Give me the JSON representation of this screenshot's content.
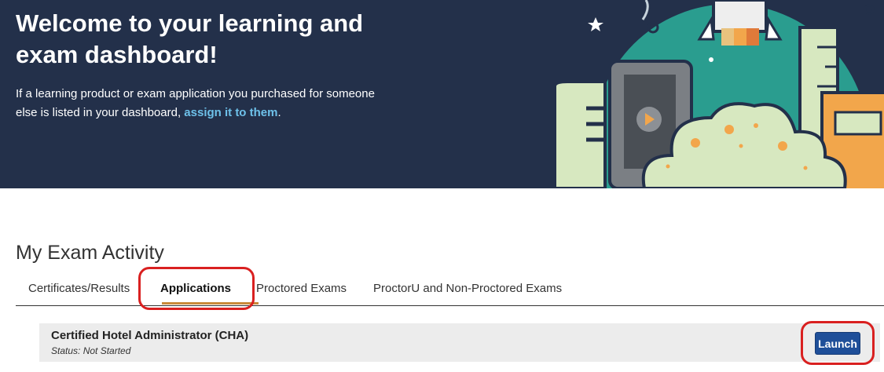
{
  "hero": {
    "title": "Welcome to your learning and exam dashboard!",
    "text_before_link": "If a learning product or exam application you purchased for someone else is listed in your dashboard, ",
    "link_text": "assign it to them",
    "text_after_link": "."
  },
  "section": {
    "title": "My Exam Activity"
  },
  "tabs": [
    {
      "label": "Certificates/Results",
      "active": false
    },
    {
      "label": "Applications",
      "active": true
    },
    {
      "label": "Proctored Exams",
      "active": false
    },
    {
      "label": "ProctorU and Non-Proctored Exams",
      "active": false
    }
  ],
  "exam": {
    "name": "Certified Hotel Administrator (CHA)",
    "status": "Status: Not Started",
    "action_label": "Launch"
  },
  "colors": {
    "hero_bg": "#23304a",
    "link": "#6ec1ea",
    "tab_underline": "#c98a3a",
    "highlight": "#d92020",
    "button": "#1f4f99"
  }
}
